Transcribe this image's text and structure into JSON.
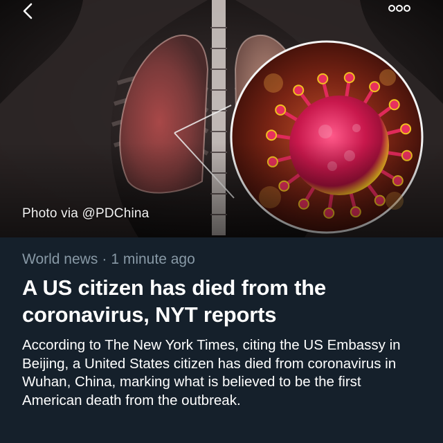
{
  "header": {
    "back_icon": "chevron-left-icon",
    "more_icon": "more-horizontal-icon"
  },
  "hero": {
    "image": "lungs-and-coronavirus-illustration",
    "credit": "Photo via @PDChina"
  },
  "article": {
    "category": "World news",
    "separator": "·",
    "time": "1 minute ago",
    "headline": "A US citizen has died from the coronavirus, NYT reports",
    "body": "According to The New York Times, citing the US Embassy in Beijing, a United States citizen has died from coronavirus in Wuhan, China, marking what is believed to be the first American death from the outbreak."
  },
  "colors": {
    "background": "#15202b",
    "meta": "#8899a6",
    "text": "#ffffff",
    "virus_core": "#c8184c",
    "virus_halo": "#f0c020"
  }
}
